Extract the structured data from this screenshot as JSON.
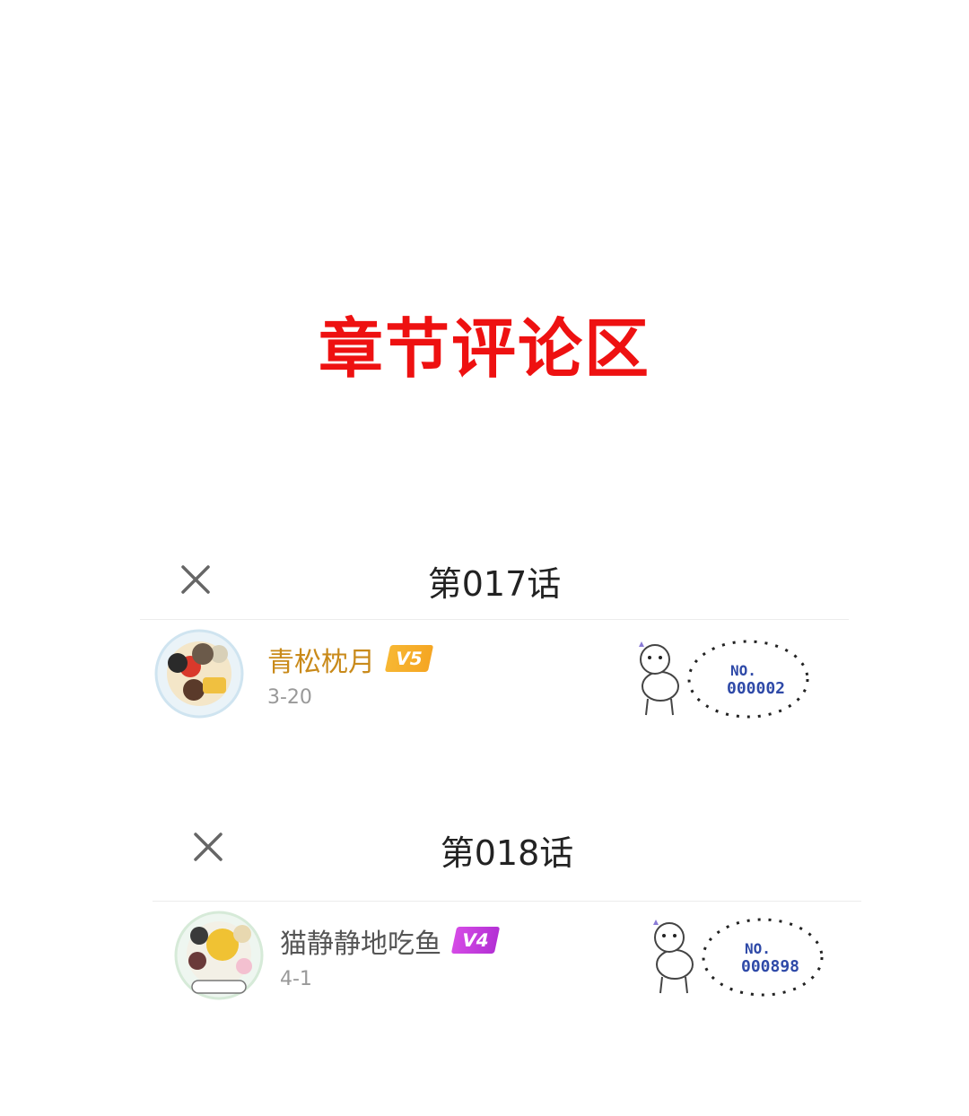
{
  "page_title": "章节评论区",
  "cards": [
    {
      "chapter": "第017话",
      "comment": {
        "username": "青松枕月",
        "level": "V5",
        "level_color": "#f5a623",
        "name_color": "#c98a1a",
        "date": "3-20",
        "fan_no_label": "NO.",
        "fan_no": "000002"
      }
    },
    {
      "chapter": "第018话",
      "comment": {
        "username": "猫静静地吃鱼",
        "level": "V4",
        "level_color": "#c83de0",
        "name_color": "#555555",
        "date": "4-1",
        "fan_no_label": "NO.",
        "fan_no": "000898"
      }
    }
  ],
  "icons": {
    "close": "close-icon",
    "avatar": "avatar",
    "badge": "fan-badge-icon"
  }
}
